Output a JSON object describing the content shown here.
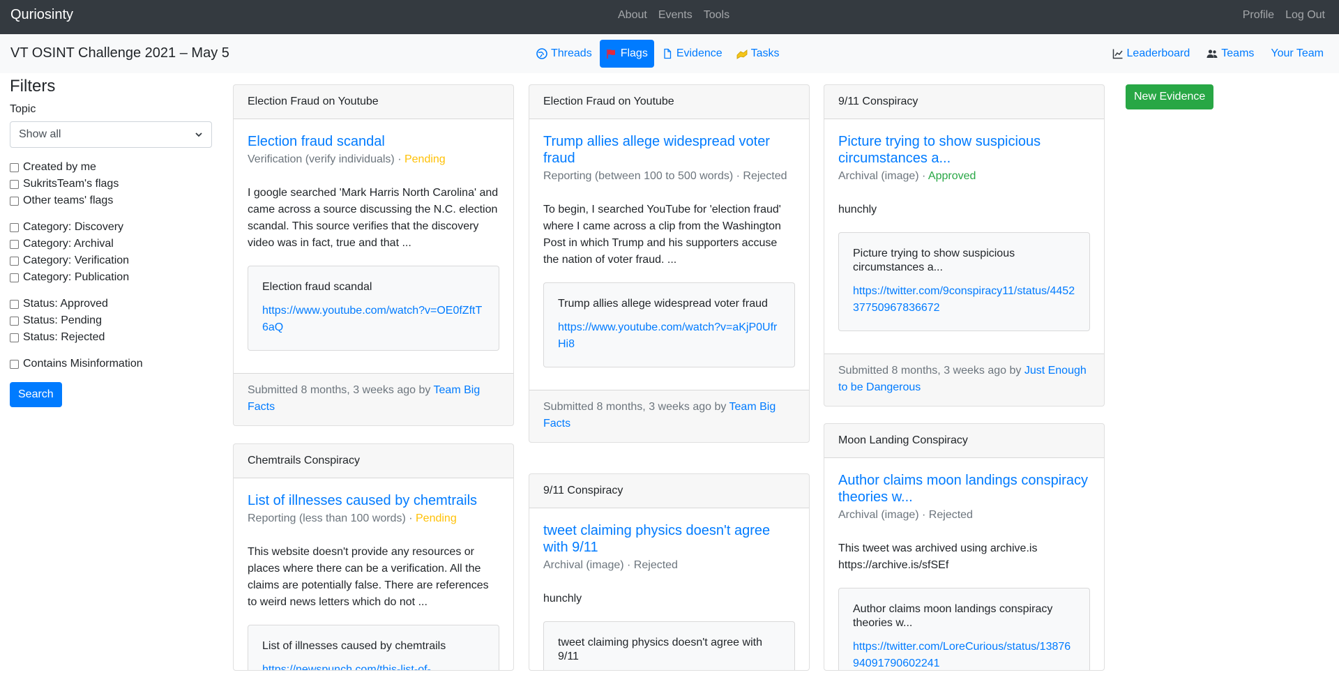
{
  "app": {
    "brand": "Quriosinty"
  },
  "topnav": {
    "items": [
      "About",
      "Events",
      "Tools"
    ],
    "right": [
      "Profile",
      "Log Out"
    ]
  },
  "subnav": {
    "title": "VT OSINT Challenge 2021 – May 5",
    "tabs": [
      {
        "label": "Threads",
        "icon": "globe-icon"
      },
      {
        "label": "Flags",
        "icon": "flag-icon",
        "active": true
      },
      {
        "label": "Evidence",
        "icon": "file-icon"
      },
      {
        "label": "Tasks",
        "icon": "tasks-icon"
      }
    ],
    "right": [
      {
        "label": "Leaderboard",
        "icon": "chart-line-icon"
      },
      {
        "label": "Teams",
        "icon": "users-icon"
      },
      {
        "label": "Your Team"
      }
    ]
  },
  "filters": {
    "heading": "Filters",
    "topic_label": "Topic",
    "topic_value": "Show all",
    "group1": [
      "Created by me",
      "SukritsTeam's flags",
      "Other teams' flags"
    ],
    "group2": [
      "Category: Discovery",
      "Category: Archival",
      "Category: Verification",
      "Category: Publication"
    ],
    "group3": [
      "Status: Approved",
      "Status: Pending",
      "Status: Rejected"
    ],
    "group4": [
      "Contains Misinformation"
    ],
    "search_label": "Search"
  },
  "actions": {
    "new_evidence": "New Evidence"
  },
  "cards": [
    {
      "header": "Election Fraud on Youtube",
      "title": "Election fraud scandal",
      "meta": "Verification (verify individuals) · ",
      "status": "Pending",
      "text": "I google searched 'Mark Harris North Carolina' and came across a source discussing the N.C. election scandal. This source verifies that the discovery video was in fact, true and that ...",
      "evidence_title": "Election fraud scandal",
      "evidence_link": "https://www.youtube.com/watch?v=OE0fZftT6aQ",
      "footer_prefix": "Submitted 8 months, 3 weeks ago by ",
      "team": "Team Big Facts"
    },
    {
      "header": "Chemtrails Conspiracy",
      "title": "List of illnesses caused by chemtrails",
      "meta": "Reporting (less than 100 words) · ",
      "status": "Pending",
      "text": "This website doesn't provide any resources or places where there can be a verification. All the claims are potentially false. There are references to weird news letters which do not ...",
      "evidence_title": "List of illnesses caused by chemtrails",
      "evidence_link": "https://newspunch.com/this-list-of-"
    },
    {
      "header": "Election Fraud on Youtube",
      "title": "Trump allies allege widespread voter fraud",
      "meta": "Reporting (between 100 to 500 words) · Rejected",
      "text": "To begin, I searched YouTube for 'election fraud' where I came across a clip from the Washington Post in which Trump and his supporters accuse the nation of voter fraud. ...",
      "evidence_title": "Trump allies allege widespread voter fraud",
      "evidence_link": "https://www.youtube.com/watch?v=aKjP0UfrHi8",
      "footer_prefix": "Submitted 8 months, 3 weeks ago by ",
      "team": "Team Big Facts"
    },
    {
      "header": "9/11 Conspiracy",
      "title": "tweet claiming physics doesn't agree with 9/11",
      "meta": "Archival (image) · Rejected",
      "text": "hunchly",
      "evidence_title": "tweet claiming physics doesn't agree with 9/11"
    },
    {
      "header": "9/11 Conspiracy",
      "title": "Picture trying to show suspicious circumstances a...",
      "meta": "Archival (image) · ",
      "status": "Approved",
      "text": "hunchly",
      "evidence_title": "Picture trying to show suspicious circumstances a...",
      "evidence_link": "https://twitter.com/9conspiracy11/status/445237750967836672",
      "footer_prefix": "Submitted 8 months, 3 weeks ago by ",
      "team": "Just Enough to be Dangerous"
    },
    {
      "header": "Moon Landing Conspiracy",
      "title": "Author claims moon landings conspiracy theories w...",
      "meta": "Archival (image) · Rejected",
      "text": "This tweet was archived using archive.is https://archive.is/sfSEf",
      "evidence_title": "Author claims moon landings conspiracy theories w...",
      "evidence_link": "https://twitter.com/LoreCurious/status/1387694091790602241"
    }
  ],
  "colors": {
    "primary": "#007bff",
    "success": "#28a745",
    "warning": "#ffc107",
    "navbar": "#343a40"
  }
}
